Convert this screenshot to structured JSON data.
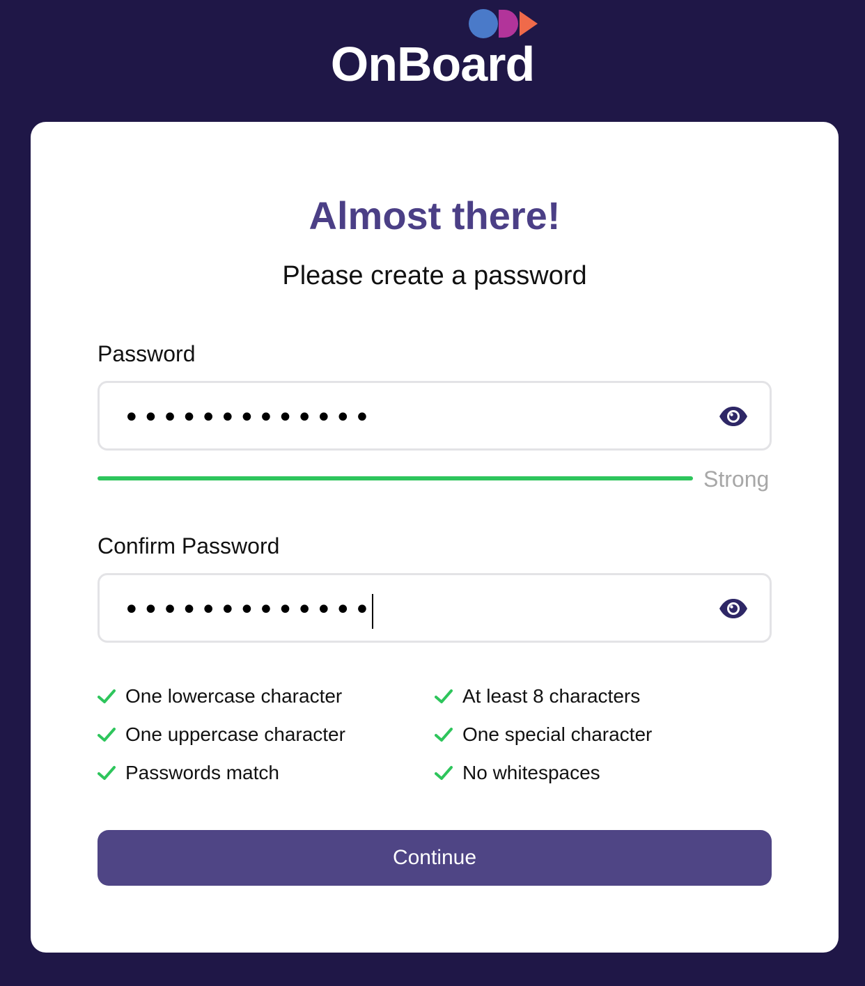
{
  "brand": {
    "name": "OnBoard",
    "logo_colors": [
      "#4a7ac9",
      "#b2349a",
      "#ef6a4a"
    ]
  },
  "card": {
    "title": "Almost there!",
    "subtitle": "Please create a password"
  },
  "password": {
    "label": "Password",
    "masked_value": "•••••••••••••",
    "toggle_icon": "eye-icon",
    "strength_label": "Strong",
    "strength_level": 1.0,
    "strength_color": "#2ec55c"
  },
  "confirm_password": {
    "label": "Confirm Password",
    "masked_value": "•••••••••••••",
    "toggle_icon": "eye-icon"
  },
  "requirements": {
    "left": [
      "One lowercase character",
      "One uppercase character",
      "Passwords match"
    ],
    "right": [
      "At least 8 characters",
      "One special character",
      "No whitespaces"
    ],
    "check_color": "#2ec55c"
  },
  "actions": {
    "continue_label": "Continue",
    "button_color": "#4f4585"
  }
}
